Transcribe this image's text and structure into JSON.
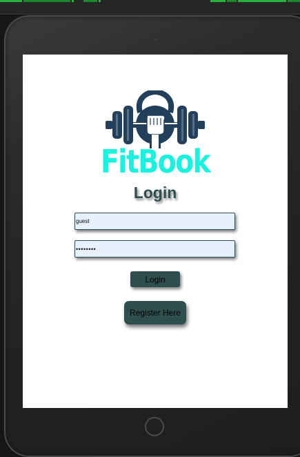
{
  "app": {
    "brand_name": "FitBook",
    "logo_icon": "kettlebell-barbell-fist-icon",
    "brand_color": "#19f2de",
    "accent_color": "#2f4f4f"
  },
  "login": {
    "title": "Login",
    "username_value": "guest",
    "password_value": "••••••••",
    "login_button": "Login",
    "register_button": "Register Here"
  }
}
